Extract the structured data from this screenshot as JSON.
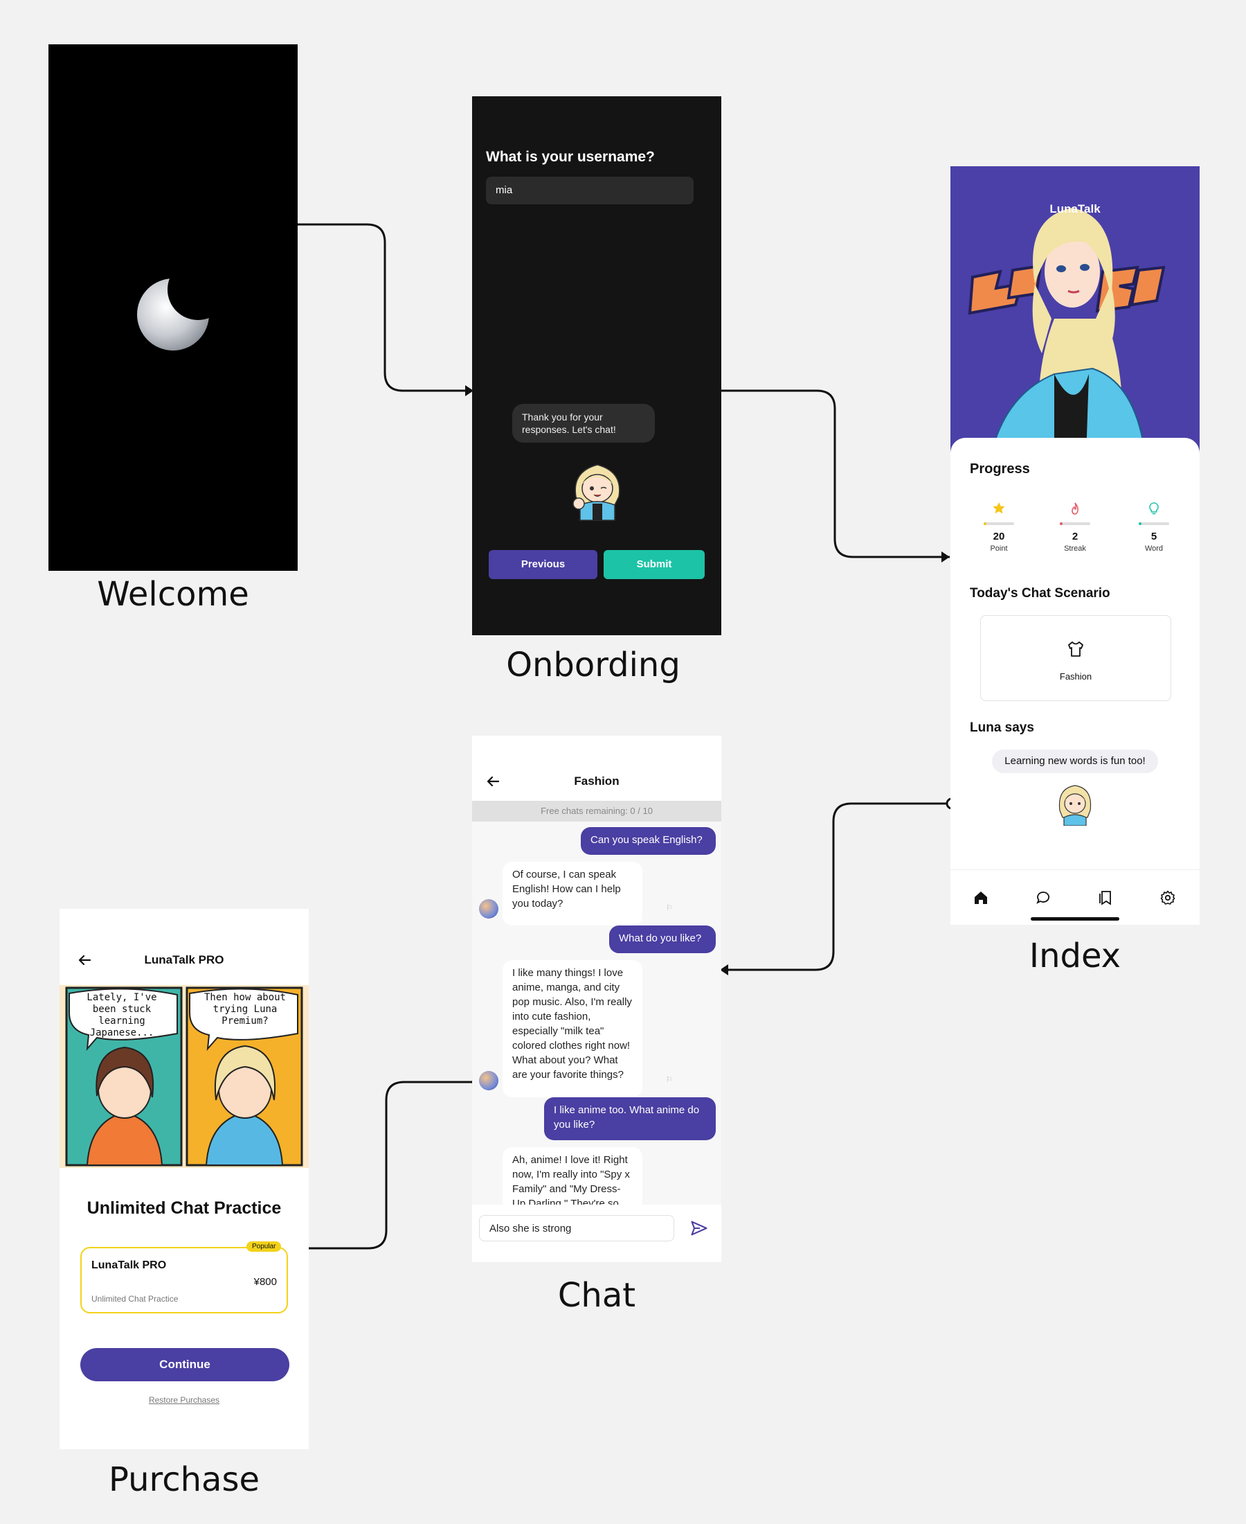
{
  "captions": {
    "welcome": "Welcome",
    "onboarding": "Onbording",
    "index": "Index",
    "chat": "Chat",
    "purchase": "Purchase"
  },
  "onboarding": {
    "question": "What is your username?",
    "username_value": "mia",
    "bubble": "Thank you for your responses. Let's chat!",
    "previous_label": "Previous",
    "submit_label": "Submit"
  },
  "index": {
    "app_title": "LunaTalk",
    "progress_title": "Progress",
    "stats": [
      {
        "value": "20",
        "label": "Point",
        "color": "#f5c518"
      },
      {
        "value": "2",
        "label": "Streak",
        "color": "#e65a6a"
      },
      {
        "value": "5",
        "label": "Word",
        "color": "#1cc3a6"
      }
    ],
    "scenario_title": "Today's Chat Scenario",
    "scenario_name": "Fashion",
    "luna_title": "Luna says",
    "luna_message": "Learning new words is fun too!",
    "tabs": [
      "home-icon",
      "chat-icon",
      "bookmark-icon",
      "settings-icon"
    ]
  },
  "chat": {
    "title": "Fashion",
    "limit_text": "Free chats remaining: 0 / 10",
    "messages": [
      {
        "role": "user",
        "text": "Can you speak English?"
      },
      {
        "role": "bot",
        "text": "Of course, I can speak English! How can I help you today?"
      },
      {
        "role": "user",
        "text": "What do you like?"
      },
      {
        "role": "bot",
        "text": "I like many things! I love anime, manga, and city pop music. Also, I'm really into cute fashion, especially \"milk tea\" colored clothes right now! What about you? What are your favorite things?"
      },
      {
        "role": "user",
        "text": "I like anime too. What anime do you like?"
      },
      {
        "role": "bot",
        "text": "Ah, anime! I love it! Right now, I'm really into \"Spy x Family\" and \"My Dress-Up Darling.\" They're so fun!"
      }
    ],
    "input_value": "Also she is strong"
  },
  "purchase": {
    "title": "LunaTalk PRO",
    "comic_left": "Lately, I've been stuck learning Japanese...",
    "comic_right": "Then how about trying Luna Premium?",
    "headline": "Unlimited Chat Practice",
    "badge": "Popular",
    "plan_name": "LunaTalk PRO",
    "price": "¥800",
    "plan_desc": "Unlimited Chat Practice",
    "continue_label": "Continue",
    "restore_label": "Restore Purchases"
  },
  "colors": {
    "accent": "#4a3fa2",
    "teal": "#1cc3a6",
    "gold": "#f3d21a"
  }
}
